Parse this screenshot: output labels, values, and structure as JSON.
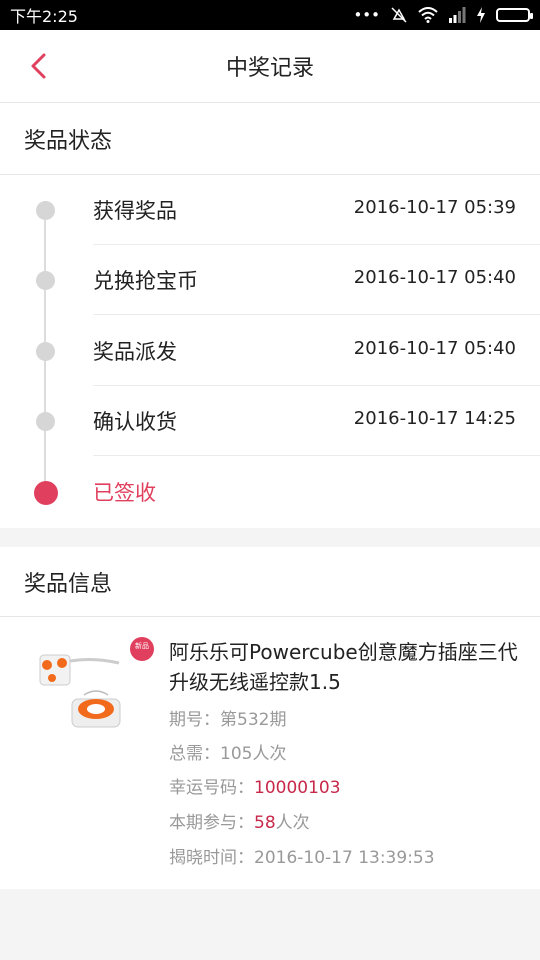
{
  "status_bar": {
    "time": "下午2:25",
    "signal_dots": "•••"
  },
  "nav": {
    "title": "中奖记录",
    "back_icon": "chevron-left-icon"
  },
  "status_section": {
    "title": "奖品状态",
    "steps": [
      {
        "label": "获得奖品",
        "time": "2016-10-17 05:39"
      },
      {
        "label": "兑换抢宝币",
        "time": "2016-10-17 05:40"
      },
      {
        "label": "奖品派发",
        "time": "2016-10-17 05:40"
      },
      {
        "label": "确认收货",
        "time": "2016-10-17 14:25"
      },
      {
        "label": "已签收",
        "time": ""
      }
    ]
  },
  "info_section": {
    "title": "奖品信息",
    "product": {
      "name": "阿乐乐可Powercube创意魔方插座三代升级无线遥控款1.5",
      "badge": "新品",
      "period_label": "期号：",
      "period_value": "第532期",
      "need_label": "总需：",
      "need_value": "105人次",
      "lucky_label": "幸运号码：",
      "lucky_value": "10000103",
      "join_label": "本期参与：",
      "join_value": "58",
      "join_unit": "人次",
      "reveal_label": "揭晓时间：",
      "reveal_value": "2016-10-17 13:39:53"
    }
  },
  "colors": {
    "accent": "#e0405e",
    "highlight": "#c8284a",
    "muted": "#999999"
  }
}
